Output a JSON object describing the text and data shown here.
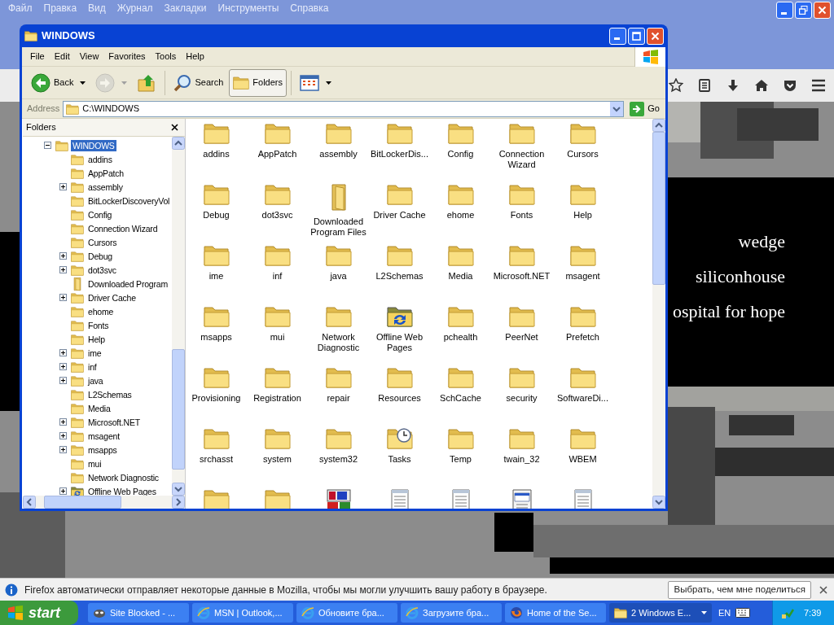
{
  "browser": {
    "menu": [
      "Файл",
      "Правка",
      "Вид",
      "Журнал",
      "Закладки",
      "Инструменты",
      "Справка"
    ]
  },
  "page": {
    "lines": [
      "wedge",
      "siliconhouse",
      "ospital for hope"
    ]
  },
  "explorer": {
    "title": "WINDOWS",
    "menu": [
      "File",
      "Edit",
      "View",
      "Favorites",
      "Tools",
      "Help"
    ],
    "toolbar": [
      {
        "kind": "back",
        "label": "Back",
        "disabled": false,
        "selected": false
      },
      {
        "kind": "forward",
        "disabled": true,
        "selected": false
      },
      {
        "kind": "up",
        "disabled": false,
        "selected": false
      },
      {
        "kind": "search",
        "label": "Search",
        "disabled": false,
        "selected": false
      },
      {
        "kind": "folders",
        "label": "Folders",
        "disabled": false,
        "selected": true
      },
      {
        "kind": "views",
        "disabled": false,
        "selected": false
      }
    ],
    "address": {
      "label": "Address",
      "value": "C:\\WINDOWS",
      "go": "Go"
    },
    "folders_pane": {
      "title": "Folders"
    },
    "tree": [
      {
        "label": "WINDOWS",
        "kind": "folder",
        "expanded": true,
        "selected": true,
        "children": [
          {
            "label": "addins",
            "kind": "folder",
            "expandable": false,
            "selected": false
          },
          {
            "label": "AppPatch",
            "kind": "folder",
            "expandable": false,
            "selected": false
          },
          {
            "label": "assembly",
            "kind": "folder",
            "expandable": true,
            "selected": false
          },
          {
            "label": "BitLockerDiscoveryVol",
            "kind": "folder",
            "expandable": false,
            "selected": false
          },
          {
            "label": "Config",
            "kind": "folder",
            "expandable": false,
            "selected": false
          },
          {
            "label": "Connection Wizard",
            "kind": "folder",
            "expandable": false,
            "selected": false
          },
          {
            "label": "Cursors",
            "kind": "folder",
            "expandable": false,
            "selected": false
          },
          {
            "label": "Debug",
            "kind": "folder",
            "expandable": true,
            "selected": false
          },
          {
            "label": "dot3svc",
            "kind": "folder",
            "expandable": true,
            "selected": false
          },
          {
            "label": "Downloaded Program",
            "kind": "downloaded",
            "expandable": false,
            "selected": false
          },
          {
            "label": "Driver Cache",
            "kind": "folder",
            "expandable": true,
            "selected": false
          },
          {
            "label": "ehome",
            "kind": "folder",
            "expandable": false,
            "selected": false
          },
          {
            "label": "Fonts",
            "kind": "folder",
            "expandable": false,
            "selected": false
          },
          {
            "label": "Help",
            "kind": "folder",
            "expandable": false,
            "selected": false
          },
          {
            "label": "ime",
            "kind": "folder",
            "expandable": true,
            "selected": false
          },
          {
            "label": "inf",
            "kind": "folder",
            "expandable": true,
            "selected": false
          },
          {
            "label": "java",
            "kind": "folder",
            "expandable": true,
            "selected": false
          },
          {
            "label": "L2Schemas",
            "kind": "folder",
            "expandable": false,
            "selected": false
          },
          {
            "label": "Media",
            "kind": "folder",
            "expandable": false,
            "selected": false
          },
          {
            "label": "Microsoft.NET",
            "kind": "folder",
            "expandable": true,
            "selected": false
          },
          {
            "label": "msagent",
            "kind": "folder",
            "expandable": true,
            "selected": false
          },
          {
            "label": "msapps",
            "kind": "folder",
            "expandable": true,
            "selected": false
          },
          {
            "label": "mui",
            "kind": "folder",
            "expandable": false,
            "selected": false
          },
          {
            "label": "Network Diagnostic",
            "kind": "folder",
            "expandable": false,
            "selected": false
          },
          {
            "label": "Offline Web Pages",
            "kind": "offline",
            "expandable": true,
            "selected": false
          }
        ]
      }
    ],
    "items": [
      {
        "label": "addins",
        "kind": "folder"
      },
      {
        "label": "AppPatch",
        "kind": "folder"
      },
      {
        "label": "assembly",
        "kind": "folder"
      },
      {
        "label": "BitLockerDis...",
        "kind": "folder"
      },
      {
        "label": "Config",
        "kind": "folder"
      },
      {
        "label": "Connection Wizard",
        "kind": "folder"
      },
      {
        "label": "Cursors",
        "kind": "folder"
      },
      {
        "label": "Debug",
        "kind": "folder"
      },
      {
        "label": "dot3svc",
        "kind": "folder"
      },
      {
        "label": "Downloaded Program Files",
        "kind": "downloaded"
      },
      {
        "label": "Driver Cache",
        "kind": "folder"
      },
      {
        "label": "ehome",
        "kind": "folder"
      },
      {
        "label": "Fonts",
        "kind": "folder"
      },
      {
        "label": "Help",
        "kind": "folder"
      },
      {
        "label": "ime",
        "kind": "folder"
      },
      {
        "label": "inf",
        "kind": "folder"
      },
      {
        "label": "java",
        "kind": "folder"
      },
      {
        "label": "L2Schemas",
        "kind": "folder"
      },
      {
        "label": "Media",
        "kind": "folder"
      },
      {
        "label": "Microsoft.NET",
        "kind": "folder"
      },
      {
        "label": "msagent",
        "kind": "folder"
      },
      {
        "label": "msapps",
        "kind": "folder"
      },
      {
        "label": "mui",
        "kind": "folder"
      },
      {
        "label": "Network Diagnostic",
        "kind": "folder"
      },
      {
        "label": "Offline Web Pages",
        "kind": "offline"
      },
      {
        "label": "pchealth",
        "kind": "folder"
      },
      {
        "label": "PeerNet",
        "kind": "folder"
      },
      {
        "label": "Prefetch",
        "kind": "folder"
      },
      {
        "label": "Provisioning",
        "kind": "folder"
      },
      {
        "label": "Registration",
        "kind": "folder"
      },
      {
        "label": "repair",
        "kind": "folder"
      },
      {
        "label": "Resources",
        "kind": "folder"
      },
      {
        "label": "SchCache",
        "kind": "folder"
      },
      {
        "label": "security",
        "kind": "folder"
      },
      {
        "label": "SoftwareDi...",
        "kind": "folder"
      },
      {
        "label": "srchasst",
        "kind": "folder"
      },
      {
        "label": "system",
        "kind": "folder"
      },
      {
        "label": "system32",
        "kind": "folder"
      },
      {
        "label": "Tasks",
        "kind": "tasks"
      },
      {
        "label": "Temp",
        "kind": "folder"
      },
      {
        "label": "twain_32",
        "kind": "folder"
      },
      {
        "label": "WBEM",
        "kind": "folder"
      },
      {
        "kind": "folder"
      },
      {
        "kind": "folder"
      },
      {
        "kind": "app"
      },
      {
        "kind": "document"
      },
      {
        "kind": "document"
      },
      {
        "kind": "settings"
      },
      {
        "kind": "document"
      }
    ]
  },
  "notification": {
    "text": "Firefox автоматически отправляет некоторые данные в Mozilla, чтобы мы могли улучшить вашу работу в браузере.",
    "button": "Выбрать, чем мне поделиться"
  },
  "taskbar": {
    "start": "start",
    "tasks": [
      {
        "label": "Site Blocked - ...",
        "kind": "blocked",
        "selected": false
      },
      {
        "label": "MSN | Outlook,...",
        "kind": "ie",
        "selected": false
      },
      {
        "label": "Обновите бра...",
        "kind": "ie",
        "selected": false
      },
      {
        "label": "Загрузите бра...",
        "kind": "ie",
        "selected": false
      },
      {
        "label": "Home of the Se...",
        "kind": "firefox",
        "selected": false
      },
      {
        "label": "2 Windows E...",
        "kind": "group",
        "selected": true
      }
    ],
    "language": "EN",
    "clock": "7:39"
  }
}
